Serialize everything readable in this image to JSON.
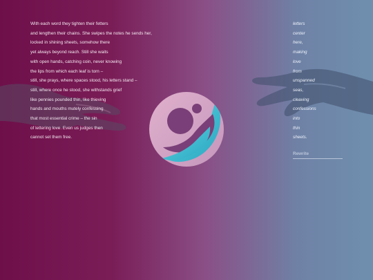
{
  "poem": {
    "lines": [
      "With each word they tighten their fetters",
      "and lengthen their chains. She swipes the notes he sends her,",
      "locked in shining sheets, somehow there",
      "yet always beyond reach. Still she waits",
      "with open hands, catching coin, never knowing",
      "the lips from which each leaf is torn –",
      "still, she prays, where spaces stood, his letters stand –",
      "still, where once he stood, she withstands grief",
      "like pennies pounded thin, like thieving",
      "hands and mouths mutely confessing",
      "that most essential crime – the sin",
      "of lettering love. Even us judges then",
      "cannot set them free."
    ]
  },
  "words": {
    "items": [
      "letters",
      "center",
      "here,",
      "making",
      "love",
      "from",
      "unspanned",
      "seas,",
      "cleaving",
      "confessions",
      "into",
      "thin",
      "sheets."
    ]
  },
  "controls": {
    "rewrite_label": "Rewrite"
  },
  "icons": {
    "logo": "swirl-moon-logo",
    "left": "hand-left-illustration",
    "right": "hand-right-illustration"
  },
  "colors": {
    "gradient_left": "#6e0f4a",
    "gradient_right": "#6f8fae",
    "logo_pink": "#d7a6c3",
    "logo_teal": "#3bbcd0"
  }
}
